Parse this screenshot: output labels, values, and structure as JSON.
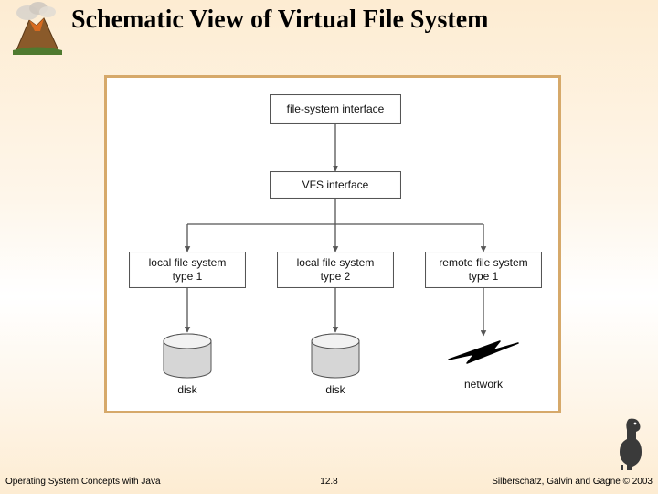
{
  "title": "Schematic View of Virtual File System",
  "footer": {
    "left": "Operating System Concepts with Java",
    "center": "12.8",
    "right": "Silberschatz, Galvin and Gagne © 2003"
  },
  "icons": {
    "volcano": "volcano-icon",
    "mascot": "dinosaur-icon"
  },
  "diagram": {
    "nodes": {
      "fs_interface": "file-system interface",
      "vfs_interface": "VFS interface",
      "local1": "local file system\ntype 1",
      "local2": "local file system\ntype 2",
      "remote1": "remote file system\ntype 1"
    },
    "storage": {
      "disk1": "disk",
      "disk2": "disk",
      "network": "network"
    }
  }
}
